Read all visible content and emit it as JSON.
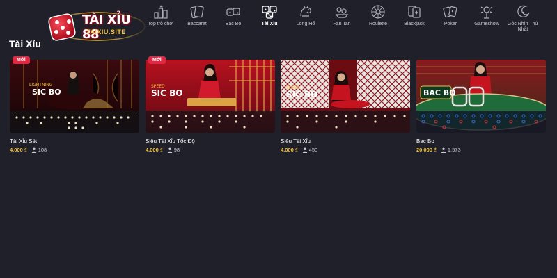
{
  "brand": {
    "title": "TÀI XỈU 88",
    "subtitle": "TAIXIU.SITE",
    "colors": {
      "red": "#c9102a",
      "gold": "#f3c23b"
    }
  },
  "nav": [
    {
      "label": "Top trò chơi",
      "icon": "top-games-icon",
      "active": false
    },
    {
      "label": "Baccarat",
      "icon": "baccarat-icon",
      "active": false
    },
    {
      "label": "Bac Bo",
      "icon": "dice-icon",
      "active": false
    },
    {
      "label": "Tài Xỉu",
      "icon": "sicbo-dice-icon",
      "active": true
    },
    {
      "label": "Long Hổ",
      "icon": "dragon-tiger-icon",
      "active": false
    },
    {
      "label": "Fan Tan",
      "icon": "fan-tan-icon",
      "active": false
    },
    {
      "label": "Roulette",
      "icon": "roulette-icon",
      "active": false
    },
    {
      "label": "Blackjack",
      "icon": "blackjack-icon",
      "active": false
    },
    {
      "label": "Poker",
      "icon": "poker-icon",
      "active": false
    },
    {
      "label": "Gameshow",
      "icon": "gameshow-icon",
      "active": false
    },
    {
      "label": "Góc Nhìn Thứ Nhất",
      "icon": "first-person-icon",
      "active": false
    }
  ],
  "section": {
    "title": "Tài Xỉu"
  },
  "games": [
    {
      "name": "Tài Xỉu Sét",
      "price": "4.000 ₫",
      "players": "108",
      "badge": "Mới",
      "logo": "LIGHTNING SIC BO"
    },
    {
      "name": "Siêu Tài Xỉu Tốc Độ",
      "price": "4.000 ₫",
      "players": "98",
      "badge": "Mới",
      "logo": "SPEED SIC BO"
    },
    {
      "name": "Siêu Tài Xỉu",
      "price": "4.000 ₫",
      "players": "450",
      "badge": "",
      "logo": "SUPER SIC BO"
    },
    {
      "name": "Bac Bo",
      "price": "20.000 ₫",
      "players": "1.573",
      "badge": "",
      "logo": "BAC BO"
    }
  ]
}
